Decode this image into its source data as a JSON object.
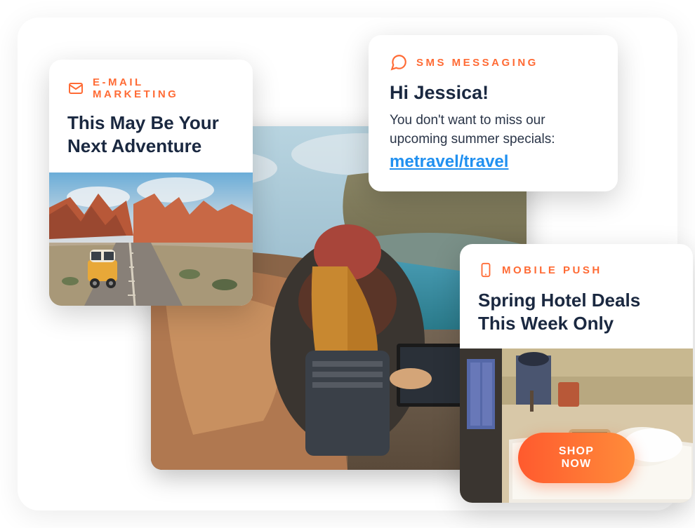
{
  "email_card": {
    "label": "E-MAIL MARKETING",
    "title": "This May Be Your Next Adventure"
  },
  "sms_card": {
    "label": "SMS MESSAGING",
    "title": "Hi Jessica!",
    "body": "You don't want to miss our upcoming summer specials:",
    "link": "metravel/travel"
  },
  "mobile_card": {
    "label": "MOBILE PUSH",
    "title": "Spring Hotel Deals This Week Only",
    "cta": "SHOP NOW"
  }
}
